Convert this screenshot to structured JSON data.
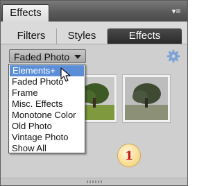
{
  "panel": {
    "title": "Effects",
    "menu_icon": "panel-menu-icon"
  },
  "tabs": [
    {
      "label": "Filters",
      "active": false
    },
    {
      "label": "Styles",
      "active": false
    },
    {
      "label": "Effects",
      "active": true
    }
  ],
  "category_dropdown": {
    "selected": "Faded Photo",
    "options": [
      "Elements+",
      "Faded Photo",
      "Frame",
      "Misc. Effects",
      "Monotone Color",
      "Old Photo",
      "Vintage Photo",
      "Show All"
    ],
    "highlighted": "Elements+"
  },
  "toolbar": {
    "settings_icon": "gear-icon"
  },
  "thumbnails": [
    {
      "name": "faded-photo-effect-1"
    },
    {
      "name": "faded-photo-effect-2"
    }
  ],
  "annotation": {
    "badge_text": "1"
  },
  "colors": {
    "selection": "#5b8ed6",
    "active_tab": "#2b2b2b",
    "badge_text": "#c0161c"
  }
}
